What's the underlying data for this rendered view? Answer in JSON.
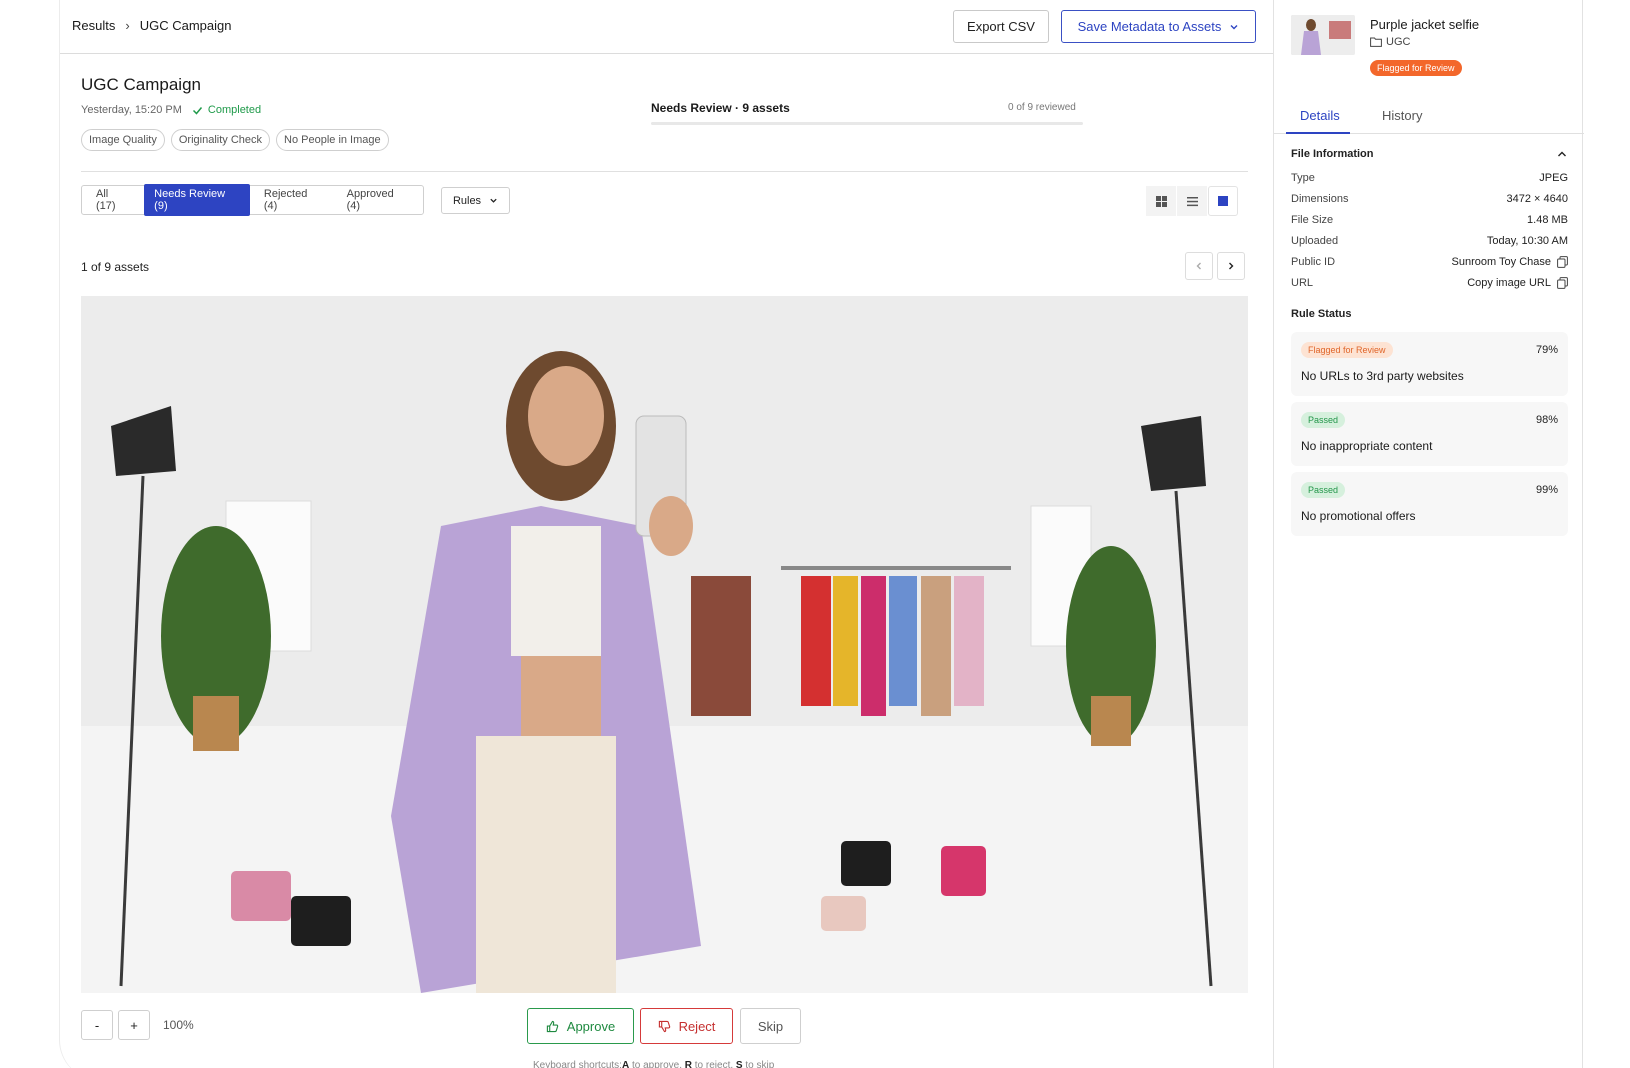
{
  "breadcrumb": {
    "root": "Results",
    "current": "UGC Campaign"
  },
  "toolbar": {
    "export_label": "Export CSV",
    "save_label": "Save Metadata to Assets"
  },
  "campaign": {
    "title": "UGC Campaign",
    "timestamp": "Yesterday, 15:20 PM",
    "status": "Completed",
    "chips": [
      "Image Quality",
      "Originality Check",
      "No People in Image"
    ]
  },
  "review": {
    "label": "Needs Review · 9 assets",
    "count_text": "0 of 9 reviewed",
    "progress_fraction": 0
  },
  "filters": {
    "tabs": [
      {
        "label": "All (17)",
        "active": false
      },
      {
        "label": "Needs Review (9)",
        "active": true
      },
      {
        "label": "Rejected (4)",
        "active": false
      },
      {
        "label": "Approved (4)",
        "active": false
      }
    ],
    "rules_label": "Rules"
  },
  "viewer": {
    "assets_count": "1 of 9 assets",
    "zoom_minus": "-",
    "zoom_plus": "+",
    "zoom_level": "100%"
  },
  "actions": {
    "approve_label": "Approve",
    "reject_label": "Reject",
    "skip_label": "Skip",
    "shortcuts_prefix": "Keyboard shortcuts:",
    "key_a": "A",
    "text_a": " to approve, ",
    "key_r": "R",
    "text_r": " to reject, ",
    "key_s": "S",
    "text_s": " to skip"
  },
  "panel": {
    "asset_name": "Purple jacket selfie",
    "folder": "UGC",
    "flag_label": "Flagged for Review",
    "tabs": {
      "details": "Details",
      "history": "History"
    },
    "file_info_title": "File Information",
    "file_info": [
      {
        "key": "Type",
        "value": "JPEG"
      },
      {
        "key": "Dimensions",
        "value": "3472 × 4640"
      },
      {
        "key": "File Size",
        "value": "1.48 MB"
      },
      {
        "key": "Uploaded",
        "value": "Today, 10:30 AM"
      },
      {
        "key": "Public ID",
        "value": "Sunroom Toy Chase"
      },
      {
        "key": "URL",
        "value": "Copy image URL"
      }
    ],
    "rule_status_title": "Rule Status",
    "rules": [
      {
        "status": "Flagged for Review",
        "percent": "79%",
        "name": "No URLs to 3rd party websites"
      },
      {
        "status": "Passed",
        "percent": "98%",
        "name": "No inappropriate content"
      },
      {
        "status": "Passed",
        "percent": "99%",
        "name": "No promotional offers"
      }
    ]
  },
  "colors": {
    "accent": "#2d44c2",
    "approve": "#2a9a4c",
    "reject": "#d53a3a",
    "flag": "#f3672b"
  }
}
